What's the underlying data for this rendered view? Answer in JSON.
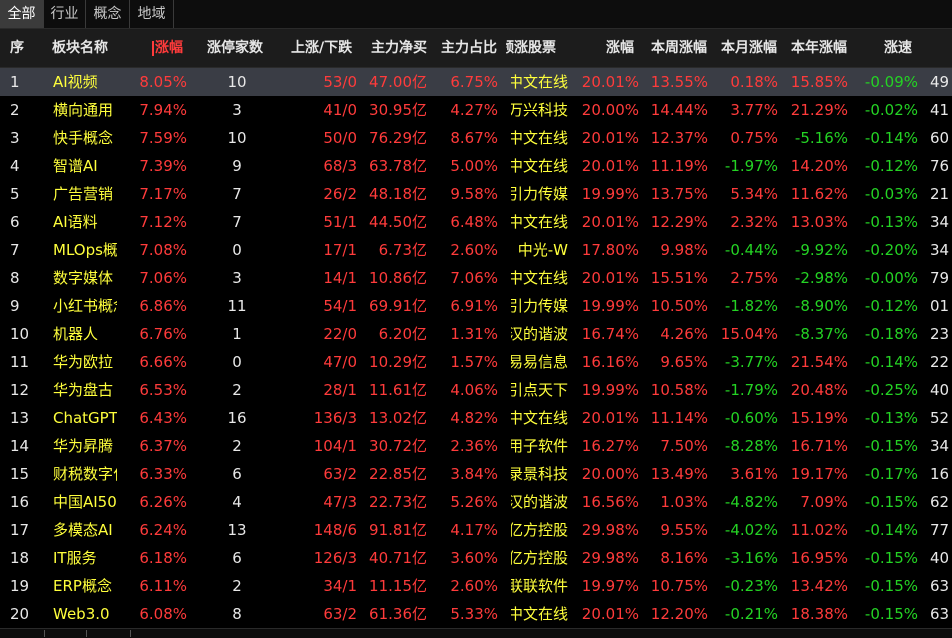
{
  "tabs": [
    "全部",
    "行业",
    "概念",
    "地域"
  ],
  "columns": [
    "序",
    "板块名称",
    "涨幅",
    "涨停家数",
    "上涨/下跌",
    "主力净买",
    "主力占比",
    "领涨股票",
    "涨幅",
    "本周涨幅",
    "本月涨幅",
    "本年涨幅",
    "涨速"
  ],
  "rows": [
    {
      "idx": "1",
      "name": "AI视频",
      "chg": "8.05%",
      "limit": "10",
      "updown": "53/0",
      "netbuy": "47.00亿",
      "ratio": "6.75%",
      "leader": "中文在线",
      "lchg": "20.01%",
      "week": "13.55%",
      "month": "0.18%",
      "year": "15.85%",
      "speed": "-0.09%",
      "extra": "49"
    },
    {
      "idx": "2",
      "name": "横向通用",
      "chg": "7.94%",
      "limit": "3",
      "updown": "41/0",
      "netbuy": "30.95亿",
      "ratio": "4.27%",
      "leader": "万兴科技",
      "lchg": "20.00%",
      "week": "14.44%",
      "month": "3.77%",
      "year": "21.29%",
      "speed": "-0.02%",
      "extra": "41"
    },
    {
      "idx": "3",
      "name": "快手概念",
      "chg": "7.59%",
      "limit": "10",
      "updown": "50/0",
      "netbuy": "76.29亿",
      "ratio": "8.67%",
      "leader": "中文在线",
      "lchg": "20.01%",
      "week": "12.37%",
      "month": "0.75%",
      "year": "-5.16%",
      "speed": "-0.14%",
      "extra": "60"
    },
    {
      "idx": "4",
      "name": "智谱AI",
      "chg": "7.39%",
      "limit": "9",
      "updown": "68/3",
      "netbuy": "63.78亿",
      "ratio": "5.00%",
      "leader": "中文在线",
      "lchg": "20.01%",
      "week": "11.19%",
      "month": "-1.97%",
      "year": "14.20%",
      "speed": "-0.12%",
      "extra": "76"
    },
    {
      "idx": "5",
      "name": "广告营销",
      "chg": "7.17%",
      "limit": "7",
      "updown": "26/2",
      "netbuy": "48.18亿",
      "ratio": "9.58%",
      "leader": "引力传媒",
      "lchg": "19.99%",
      "week": "13.75%",
      "month": "5.34%",
      "year": "11.62%",
      "speed": "-0.03%",
      "extra": "21"
    },
    {
      "idx": "6",
      "name": "AI语料",
      "chg": "7.12%",
      "limit": "7",
      "updown": "51/1",
      "netbuy": "44.50亿",
      "ratio": "6.48%",
      "leader": "中文在线",
      "lchg": "20.01%",
      "week": "12.29%",
      "month": "2.32%",
      "year": "13.03%",
      "speed": "-0.13%",
      "extra": "34"
    },
    {
      "idx": "7",
      "name": "MLOps概念",
      "chg": "7.08%",
      "limit": "0",
      "updown": "17/1",
      "netbuy": "6.73亿",
      "ratio": "2.60%",
      "leader": "中光-W",
      "lchg": "17.80%",
      "week": "9.98%",
      "month": "-0.44%",
      "year": "-9.92%",
      "speed": "-0.20%",
      "extra": "34"
    },
    {
      "idx": "8",
      "name": "数字媒体",
      "chg": "7.06%",
      "limit": "3",
      "updown": "14/1",
      "netbuy": "10.86亿",
      "ratio": "7.06%",
      "leader": "中文在线",
      "lchg": "20.01%",
      "week": "15.51%",
      "month": "2.75%",
      "year": "-2.98%",
      "speed": "-0.00%",
      "extra": "79"
    },
    {
      "idx": "9",
      "name": "小红书概念",
      "chg": "6.86%",
      "limit": "11",
      "updown": "54/1",
      "netbuy": "69.91亿",
      "ratio": "6.91%",
      "leader": "引力传媒",
      "lchg": "19.99%",
      "week": "10.50%",
      "month": "-1.82%",
      "year": "-8.90%",
      "speed": "-0.12%",
      "extra": "01"
    },
    {
      "idx": "10",
      "name": "机器人",
      "chg": "6.76%",
      "limit": "1",
      "updown": "22/0",
      "netbuy": "6.20亿",
      "ratio": "1.31%",
      "leader": "汉的谐波",
      "lchg": "16.74%",
      "week": "4.26%",
      "month": "15.04%",
      "year": "-8.37%",
      "speed": "-0.18%",
      "extra": "23"
    },
    {
      "idx": "11",
      "name": "华为欧拉",
      "chg": "6.66%",
      "limit": "0",
      "updown": "47/0",
      "netbuy": "10.29亿",
      "ratio": "1.57%",
      "leader": "易易信息",
      "lchg": "16.16%",
      "week": "9.65%",
      "month": "-3.77%",
      "year": "21.54%",
      "speed": "-0.14%",
      "extra": "22"
    },
    {
      "idx": "12",
      "name": "华为盘古",
      "chg": "6.53%",
      "limit": "2",
      "updown": "28/1",
      "netbuy": "11.61亿",
      "ratio": "4.06%",
      "leader": "引点天下",
      "lchg": "19.99%",
      "week": "10.58%",
      "month": "-1.79%",
      "year": "20.48%",
      "speed": "-0.25%",
      "extra": "40"
    },
    {
      "idx": "13",
      "name": "ChatGPT",
      "chg": "6.43%",
      "limit": "16",
      "updown": "136/3",
      "netbuy": "13.02亿",
      "ratio": "4.82%",
      "leader": "中文在线",
      "lchg": "20.01%",
      "week": "11.14%",
      "month": "-0.60%",
      "year": "15.19%",
      "speed": "-0.13%",
      "extra": "52"
    },
    {
      "idx": "14",
      "name": "华为昇腾",
      "chg": "6.37%",
      "limit": "2",
      "updown": "104/1",
      "netbuy": "30.72亿",
      "ratio": "2.36%",
      "leader": "用子软件",
      "lchg": "16.27%",
      "week": "7.50%",
      "month": "-8.28%",
      "year": "16.71%",
      "speed": "-0.15%",
      "extra": "34"
    },
    {
      "idx": "15",
      "name": "财税数字化",
      "chg": "6.33%",
      "limit": "6",
      "updown": "63/2",
      "netbuy": "22.85亿",
      "ratio": "3.84%",
      "leader": "录景科技",
      "lchg": "20.00%",
      "week": "13.49%",
      "month": "3.61%",
      "year": "19.17%",
      "speed": "-0.17%",
      "extra": "16"
    },
    {
      "idx": "16",
      "name": "中国AI50",
      "chg": "6.26%",
      "limit": "4",
      "updown": "47/3",
      "netbuy": "22.73亿",
      "ratio": "5.26%",
      "leader": "汉的谐波",
      "lchg": "16.56%",
      "week": "1.03%",
      "month": "-4.82%",
      "year": "7.09%",
      "speed": "-0.15%",
      "extra": "62"
    },
    {
      "idx": "17",
      "name": "多模态AI",
      "chg": "6.24%",
      "limit": "13",
      "updown": "148/6",
      "netbuy": "91.81亿",
      "ratio": "4.17%",
      "leader": "亿方控股",
      "lchg": "29.98%",
      "week": "9.55%",
      "month": "-4.02%",
      "year": "11.02%",
      "speed": "-0.14%",
      "extra": "77"
    },
    {
      "idx": "18",
      "name": "IT服务",
      "chg": "6.18%",
      "limit": "6",
      "updown": "126/3",
      "netbuy": "40.71亿",
      "ratio": "3.60%",
      "leader": "亿方控股",
      "lchg": "29.98%",
      "week": "8.16%",
      "month": "-3.16%",
      "year": "16.95%",
      "speed": "-0.15%",
      "extra": "40"
    },
    {
      "idx": "19",
      "name": "ERP概念",
      "chg": "6.11%",
      "limit": "2",
      "updown": "34/1",
      "netbuy": "11.15亿",
      "ratio": "2.60%",
      "leader": "联联软件",
      "lchg": "19.97%",
      "week": "10.75%",
      "month": "-0.23%",
      "year": "13.42%",
      "speed": "-0.15%",
      "extra": "63"
    },
    {
      "idx": "20",
      "name": "Web3.0",
      "chg": "6.08%",
      "limit": "8",
      "updown": "63/2",
      "netbuy": "61.36亿",
      "ratio": "5.33%",
      "leader": "中文在线",
      "lchg": "20.01%",
      "week": "12.20%",
      "month": "-0.21%",
      "year": "18.38%",
      "speed": "-0.15%",
      "extra": "63"
    }
  ]
}
